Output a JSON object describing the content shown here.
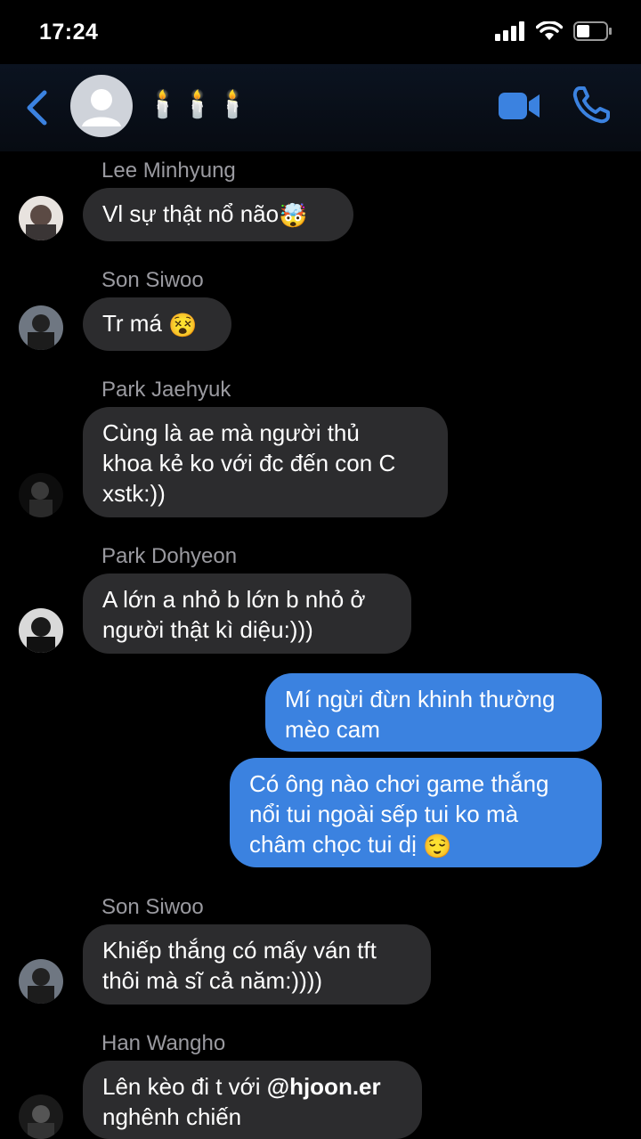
{
  "status": {
    "time": "17:24"
  },
  "header": {
    "title": "🕯️🕯️🕯️"
  },
  "messages": [
    {
      "sender": "Lee Minhyung",
      "text": "Vl sự thật nổ não",
      "emoji": "🤯"
    },
    {
      "sender": "Son Siwoo",
      "text": "Tr má",
      "emoji": "😵"
    },
    {
      "sender": "Park Jaehyuk",
      "line1": "Cùng là ae mà người thủ",
      "line2": "khoa kẻ ko với đc đến con C",
      "line3": "xstk:))"
    },
    {
      "sender": "Park Dohyeon",
      "line1": "A lớn a nhỏ b lớn b nhỏ ở",
      "line2": "người thật kì diệu:)))"
    },
    {
      "line1": "Mí ngừi đừn khinh thường",
      "line2": "mèo cam"
    },
    {
      "line1": "Có ông nào chơi game thắng",
      "line2": "nổi tui ngoài sếp tui ko mà",
      "line3": "châm chọc tui dị",
      "emoji": "😌"
    },
    {
      "sender": "Son Siwoo",
      "line1": "Khiếp thắng có mấy ván tft",
      "line2": "thôi mà sĩ cả năm:))))"
    },
    {
      "sender": "Han Wangho",
      "line1_pre": "Lên kèo đi t với ",
      "mention": "@hjoon.er",
      "line2": "nghênh chiến"
    }
  ],
  "colors": {
    "accent": "#3b82e0",
    "incoming": "#2c2c2e",
    "background": "#000000"
  },
  "icons": [
    "back-chevron-icon",
    "video-call-icon",
    "phone-call-icon",
    "signal-icon",
    "wifi-icon",
    "battery-icon"
  ]
}
